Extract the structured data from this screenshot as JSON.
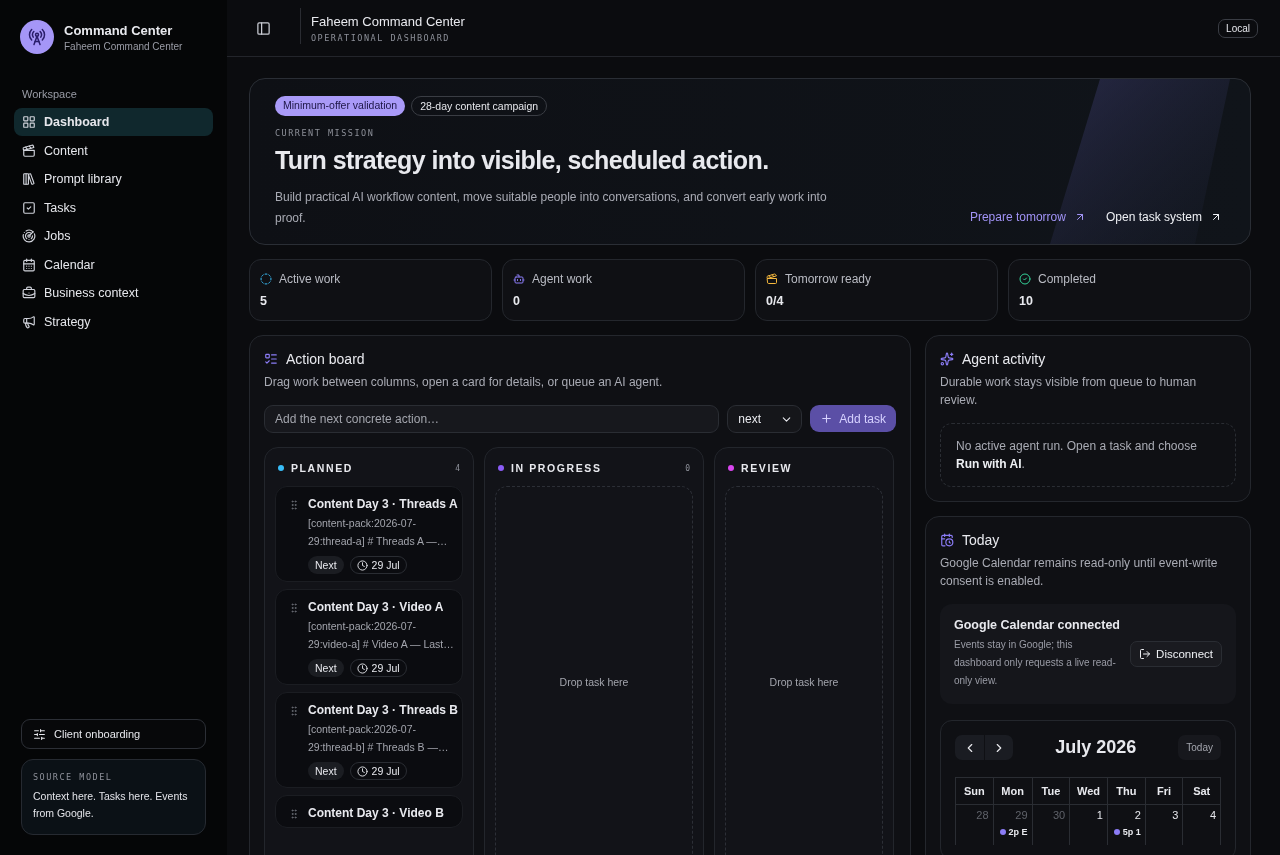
{
  "brand": {
    "title": "Command Center",
    "subtitle": "Faheem Command Center"
  },
  "sidebar": {
    "section_label": "Workspace",
    "items": [
      {
        "label": "Dashboard",
        "selected": true
      },
      {
        "label": "Content",
        "selected": false
      },
      {
        "label": "Prompt library",
        "selected": false
      },
      {
        "label": "Tasks",
        "selected": false
      },
      {
        "label": "Jobs",
        "selected": false
      },
      {
        "label": "Calendar",
        "selected": false
      },
      {
        "label": "Business context",
        "selected": false
      },
      {
        "label": "Strategy",
        "selected": false
      }
    ],
    "footer_button": "Client onboarding",
    "source_model": {
      "label": "SOURCE MODEL",
      "text": "Context here. Tasks here. Events from Google."
    }
  },
  "header": {
    "title": "Faheem Command Center",
    "subtitle": "OPERATIONAL DASHBOARD",
    "badge": "Local"
  },
  "hero": {
    "tags": [
      {
        "label": "Minimum-offer validation",
        "kind": "accent"
      },
      {
        "label": "28-day content campaign",
        "kind": "outline"
      }
    ],
    "eyebrow": "CURRENT MISSION",
    "title": "Turn strategy into visible, scheduled action.",
    "text": "Build practical AI workflow content, move suitable people into conversations, and convert early work into proof.",
    "links": [
      {
        "label": "Prepare tomorrow",
        "kind": "accent"
      },
      {
        "label": "Open task system",
        "kind": "plain"
      }
    ]
  },
  "stats": [
    {
      "label": "Active work",
      "value": "5"
    },
    {
      "label": "Agent work",
      "value": "0"
    },
    {
      "label": "Tomorrow ready",
      "value": "0/4"
    },
    {
      "label": "Completed",
      "value": "10"
    }
  ],
  "action_board": {
    "title": "Action board",
    "subtitle": "Drag work between columns, open a card for details, or queue an AI agent.",
    "input_placeholder": "Add the next concrete action…",
    "select_value": "next",
    "add_button": "Add task",
    "columns": [
      {
        "name": "PLANNED",
        "count": "4",
        "color": "#38bdf8",
        "cards": [
          {
            "title": "Content Day 3 · Threads A",
            "body": "[content-pack:2026-07-29:thread-a] # Threads A —…",
            "tag": "Next",
            "date": "29 Jul"
          },
          {
            "title": "Content Day 3 · Video A",
            "body": "[content-pack:2026-07-29:video-a] # Video A — Last…",
            "tag": "Next",
            "date": "29 Jul"
          },
          {
            "title": "Content Day 3 · Threads B",
            "body": "[content-pack:2026-07-29:thread-b] # Threads B —…",
            "tag": "Next",
            "date": "29 Jul"
          },
          {
            "title": "Content Day 3 · Video B"
          }
        ]
      },
      {
        "name": "IN PROGRESS",
        "count": "0",
        "color": "#8b5cf6",
        "empty_text": "Drop task here"
      },
      {
        "name": "REVIEW",
        "color": "#d946ef",
        "empty_text": "Drop task here"
      }
    ]
  },
  "agent_activity": {
    "title": "Agent activity",
    "subtitle": "Durable work stays visible from queue to human review.",
    "empty_text": "No active agent run. Open a task and choose **Run with AI**."
  },
  "today": {
    "title": "Today",
    "subtitle": "Google Calendar remains read-only until event-write consent is enabled.",
    "connection": {
      "title": "Google Calendar connected",
      "text": "Events stay in Google; this dashboard only requests a live read-only view.",
      "button": "Disconnect"
    },
    "calendar": {
      "month": "July 2026",
      "today_button": "Today",
      "weekdays": [
        "Sun",
        "Mon",
        "Tue",
        "Wed",
        "Thu",
        "Fri",
        "Sat"
      ],
      "days": [
        {
          "day": "28",
          "outside": true
        },
        {
          "day": "29",
          "outside": true,
          "event": {
            "label": "2p E",
            "color": "#8b7cf6"
          }
        },
        {
          "day": "30",
          "outside": true
        },
        {
          "day": "1",
          "outside": false
        },
        {
          "day": "2",
          "outside": false,
          "event": {
            "label": "5p 1",
            "color": "#8b7cf6"
          }
        },
        {
          "day": "3",
          "outside": false
        },
        {
          "day": "4",
          "outside": false
        }
      ]
    }
  }
}
